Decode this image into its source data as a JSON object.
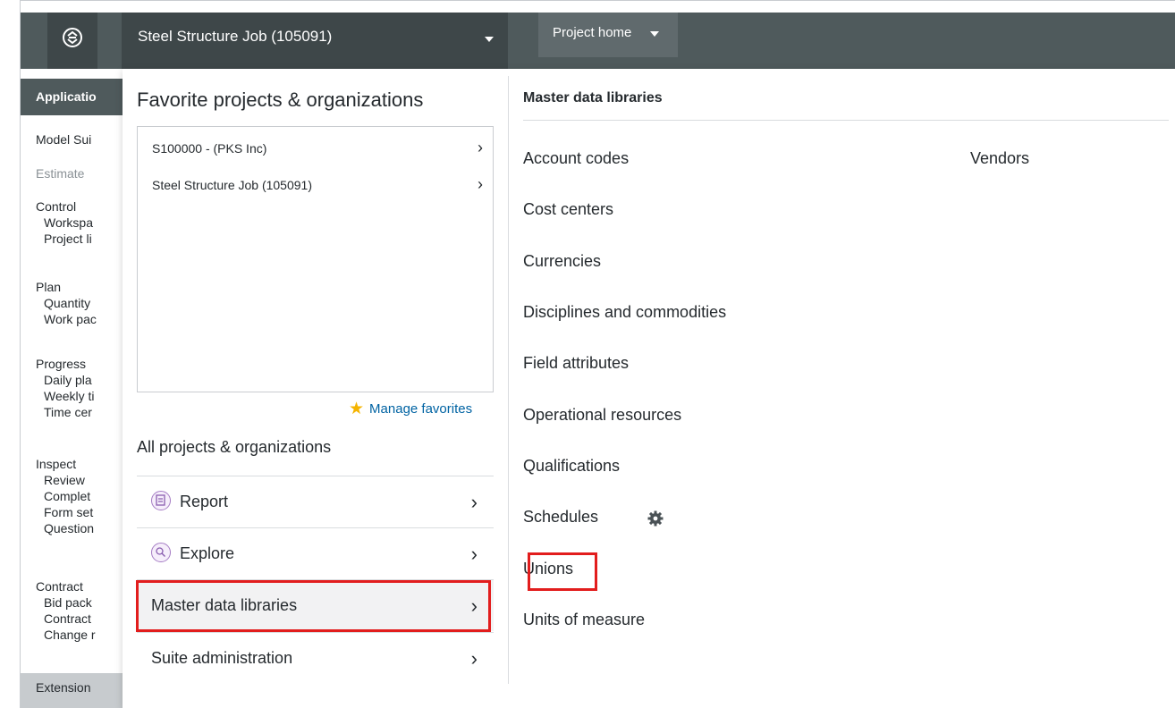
{
  "topbar": {
    "project_title": "Steel Structure Job (105091)",
    "home_label": "Project home"
  },
  "sidebar": {
    "header": "Applicatio",
    "items": [
      {
        "label": "Model Sui",
        "sub": false,
        "muted": false
      },
      {
        "label": "Estimate",
        "sub": false,
        "muted": true
      },
      {
        "label": "Control",
        "sub": false,
        "muted": false
      },
      {
        "label": "Workspa",
        "sub": true,
        "muted": false
      },
      {
        "label": "Project li",
        "sub": true,
        "muted": false
      },
      {
        "label": "Plan",
        "sub": false,
        "muted": false
      },
      {
        "label": "Quantity",
        "sub": true,
        "muted": false
      },
      {
        "label": "Work pac",
        "sub": true,
        "muted": false
      },
      {
        "label": "Progress",
        "sub": false,
        "muted": false
      },
      {
        "label": "Daily pla",
        "sub": true,
        "muted": false
      },
      {
        "label": "Weekly ti",
        "sub": true,
        "muted": false
      },
      {
        "label": "Time cer",
        "sub": true,
        "muted": false
      },
      {
        "label": "Inspect",
        "sub": false,
        "muted": false
      },
      {
        "label": "Review",
        "sub": true,
        "muted": false
      },
      {
        "label": "Complet",
        "sub": true,
        "muted": false
      },
      {
        "label": "Form set",
        "sub": true,
        "muted": false
      },
      {
        "label": "Question",
        "sub": true,
        "muted": false
      },
      {
        "label": "Contract",
        "sub": false,
        "muted": false
      },
      {
        "label": "Bid pack",
        "sub": true,
        "muted": false
      },
      {
        "label": "Contract",
        "sub": true,
        "muted": false
      },
      {
        "label": "Change r",
        "sub": true,
        "muted": false
      }
    ],
    "extensions": "Extension"
  },
  "menu": {
    "favorites_title": "Favorite projects & organizations",
    "favorites": [
      {
        "label": "S100000 - (PKS Inc)"
      },
      {
        "label": "Steel Structure Job (105091)"
      }
    ],
    "manage_favorites": "Manage favorites",
    "all_projects": "All projects & organizations",
    "rows": [
      {
        "label": "Report",
        "icon": "report-icon"
      },
      {
        "label": "Explore",
        "icon": "explore-icon"
      },
      {
        "label": "Master data libraries",
        "icon": null,
        "active": true
      },
      {
        "label": "Suite administration",
        "icon": null
      }
    ],
    "chevron": "›"
  },
  "master_data": {
    "title": "Master data libraries",
    "libraries": [
      "Account codes",
      "Cost centers",
      "Currencies",
      "Disciplines and commodities",
      "Field attributes",
      "Operational resources",
      "Qualifications",
      "Schedules",
      "Unions",
      "Units of measure"
    ],
    "libraries_col2": [
      "Vendors"
    ],
    "highlighted": "Unions"
  },
  "colors": {
    "topbar": "#4f5a5c",
    "highlight": "#e21d1d",
    "link": "#0063a3",
    "star": "#f5b400"
  }
}
